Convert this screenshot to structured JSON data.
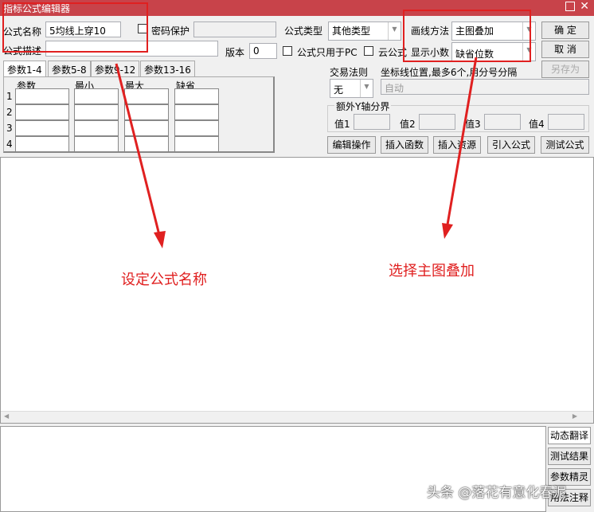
{
  "window": {
    "title": "指标公式编辑器"
  },
  "form": {
    "name_label": "公式名称",
    "name_value": "5均线上穿10",
    "password_label": "密码保护",
    "desc_label": "公式描述",
    "version_label": "版本",
    "version_value": "0",
    "type_label": "公式类型",
    "type_value": "其他类型",
    "pc_only_label": "公式只用于PC",
    "cloud_label": "云公式",
    "draw_label": "画线方法",
    "draw_value": "主图叠加",
    "decimal_label": "显示小数",
    "decimal_value": "缺省位数"
  },
  "buttons": {
    "ok": "确  定",
    "cancel": "取  消",
    "save_as": "另存为",
    "edit": "编辑操作",
    "insert_func": "插入函数",
    "insert_res": "插入资源",
    "import": "引入公式",
    "test": "测试公式"
  },
  "tabs": [
    "参数1-4",
    "参数5-8",
    "参数9-12",
    "参数13-16"
  ],
  "params": {
    "headers": [
      "参数",
      "最小",
      "最大",
      "缺省"
    ],
    "rows": [
      "1",
      "2",
      "3",
      "4"
    ]
  },
  "trade": {
    "label": "交易法则",
    "value": "无",
    "axis_label": "坐标线位置,最多6个,用分号分隔",
    "axis_value": "自动"
  },
  "yaxis": {
    "legend": "额外Y轴分界",
    "values": [
      "值1",
      "值2",
      "值3",
      "值4"
    ]
  },
  "side_buttons": [
    "动态翻译",
    "测试结果",
    "参数精灵",
    "用法注释"
  ],
  "annotations": {
    "left": "设定公式名称",
    "right": "选择主图叠加"
  },
  "watermark": "头条 @落花有意化春泥"
}
